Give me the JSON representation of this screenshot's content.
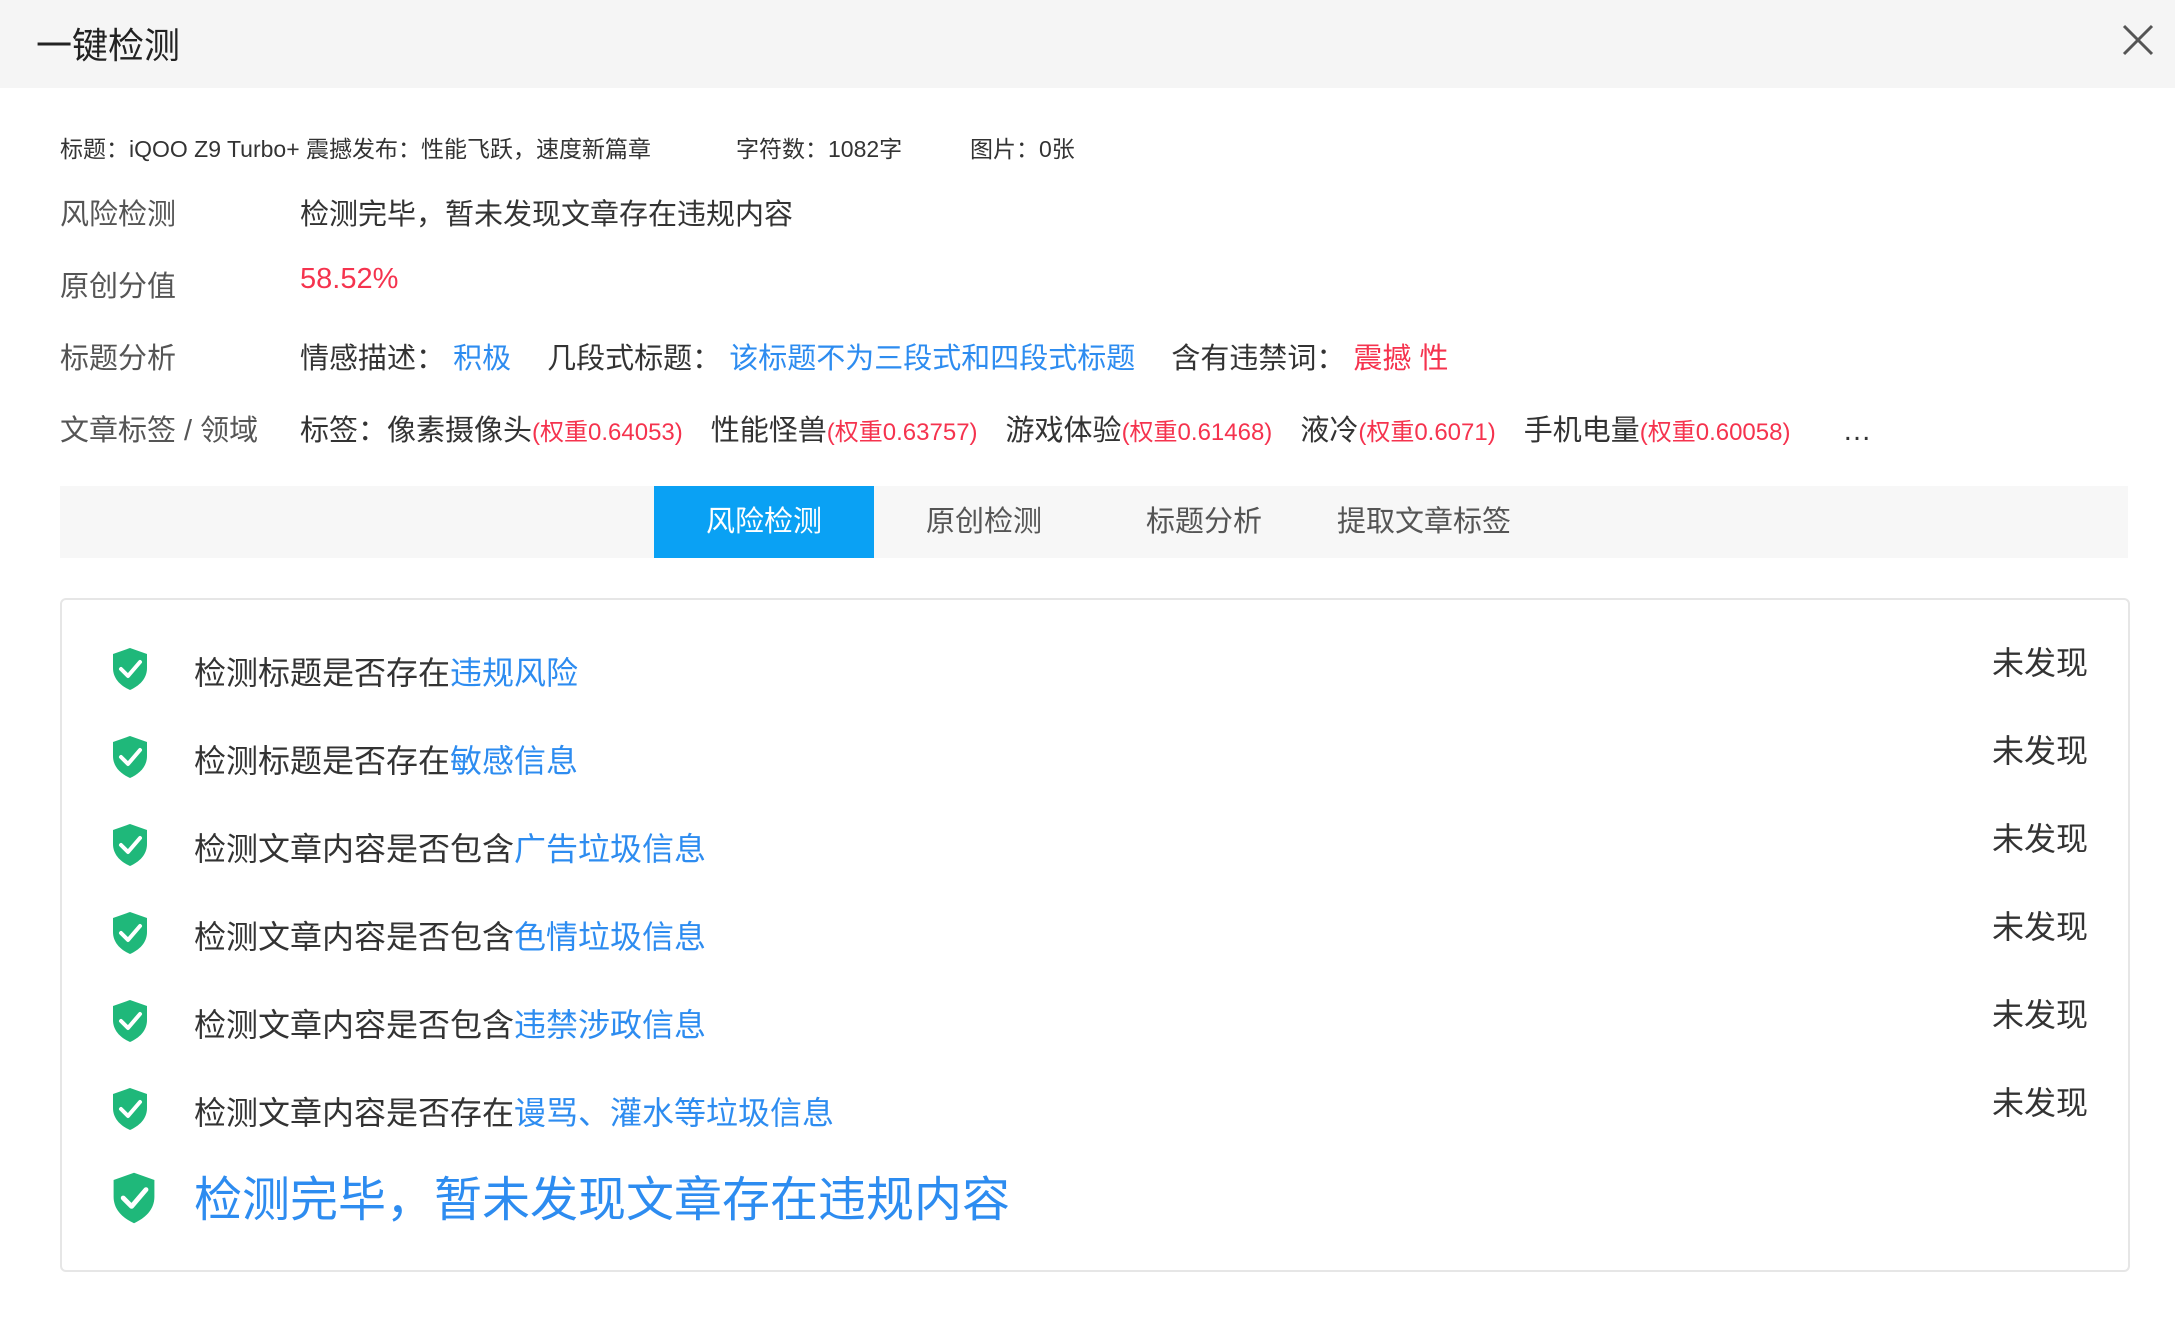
{
  "header": {
    "title": "一键检测"
  },
  "meta": {
    "title": "标题：iQOO Z9 Turbo+ 震撼发布：性能飞跃，速度新篇章",
    "chars": "字符数：1082字",
    "images": "图片：0张"
  },
  "risk": {
    "label": "风险检测",
    "value": "检测完毕，暂未发现文章存在违规内容"
  },
  "originality": {
    "label": "原创分值",
    "value": "58.52%"
  },
  "title_analysis": {
    "label": "标题分析",
    "sentiment_label": "情感描述：",
    "sentiment_value": "积极",
    "segment_label": "几段式标题：",
    "segment_value": "该标题不为三段式和四段式标题",
    "banned_label": "含有违禁词：",
    "banned_value": "震撼 性"
  },
  "tags_row": {
    "label": "文章标签 / 领域",
    "prefix": "标签：",
    "tags": [
      {
        "name": "像素摄像头",
        "weight": "(权重0.64053)"
      },
      {
        "name": "性能怪兽",
        "weight": "(权重0.63757)"
      },
      {
        "name": "游戏体验",
        "weight": "(权重0.61468)"
      },
      {
        "name": "液冷",
        "weight": "(权重0.6071)"
      },
      {
        "name": "手机电量",
        "weight": "(权重0.60058)"
      }
    ],
    "more": "…"
  },
  "tabs": [
    {
      "label": "风险检测",
      "active": true
    },
    {
      "label": "原创检测",
      "active": false
    },
    {
      "label": "标题分析",
      "active": false
    },
    {
      "label": "提取文章标签",
      "active": false
    }
  ],
  "checks": [
    {
      "prefix": "检测标题是否存在",
      "highlight": "违规风险",
      "status": "未发现"
    },
    {
      "prefix": "检测标题是否存在",
      "highlight": "敏感信息",
      "status": "未发现"
    },
    {
      "prefix": "检测文章内容是否包含",
      "highlight": "广告垃圾信息",
      "status": "未发现"
    },
    {
      "prefix": "检测文章内容是否包含",
      "highlight": "色情垃圾信息",
      "status": "未发现"
    },
    {
      "prefix": "检测文章内容是否包含",
      "highlight": "违禁涉政信息",
      "status": "未发现"
    },
    {
      "prefix": "检测文章内容是否存在",
      "highlight": "谩骂、灌水等垃圾信息",
      "status": "未发现"
    }
  ],
  "final_message": "检测完毕，暂未发现文章存在违规内容",
  "colors": {
    "accent": "#2d8cf0",
    "tab_active": "#0aa1f4",
    "danger": "#f5334e",
    "shield": "#1fb87a"
  }
}
